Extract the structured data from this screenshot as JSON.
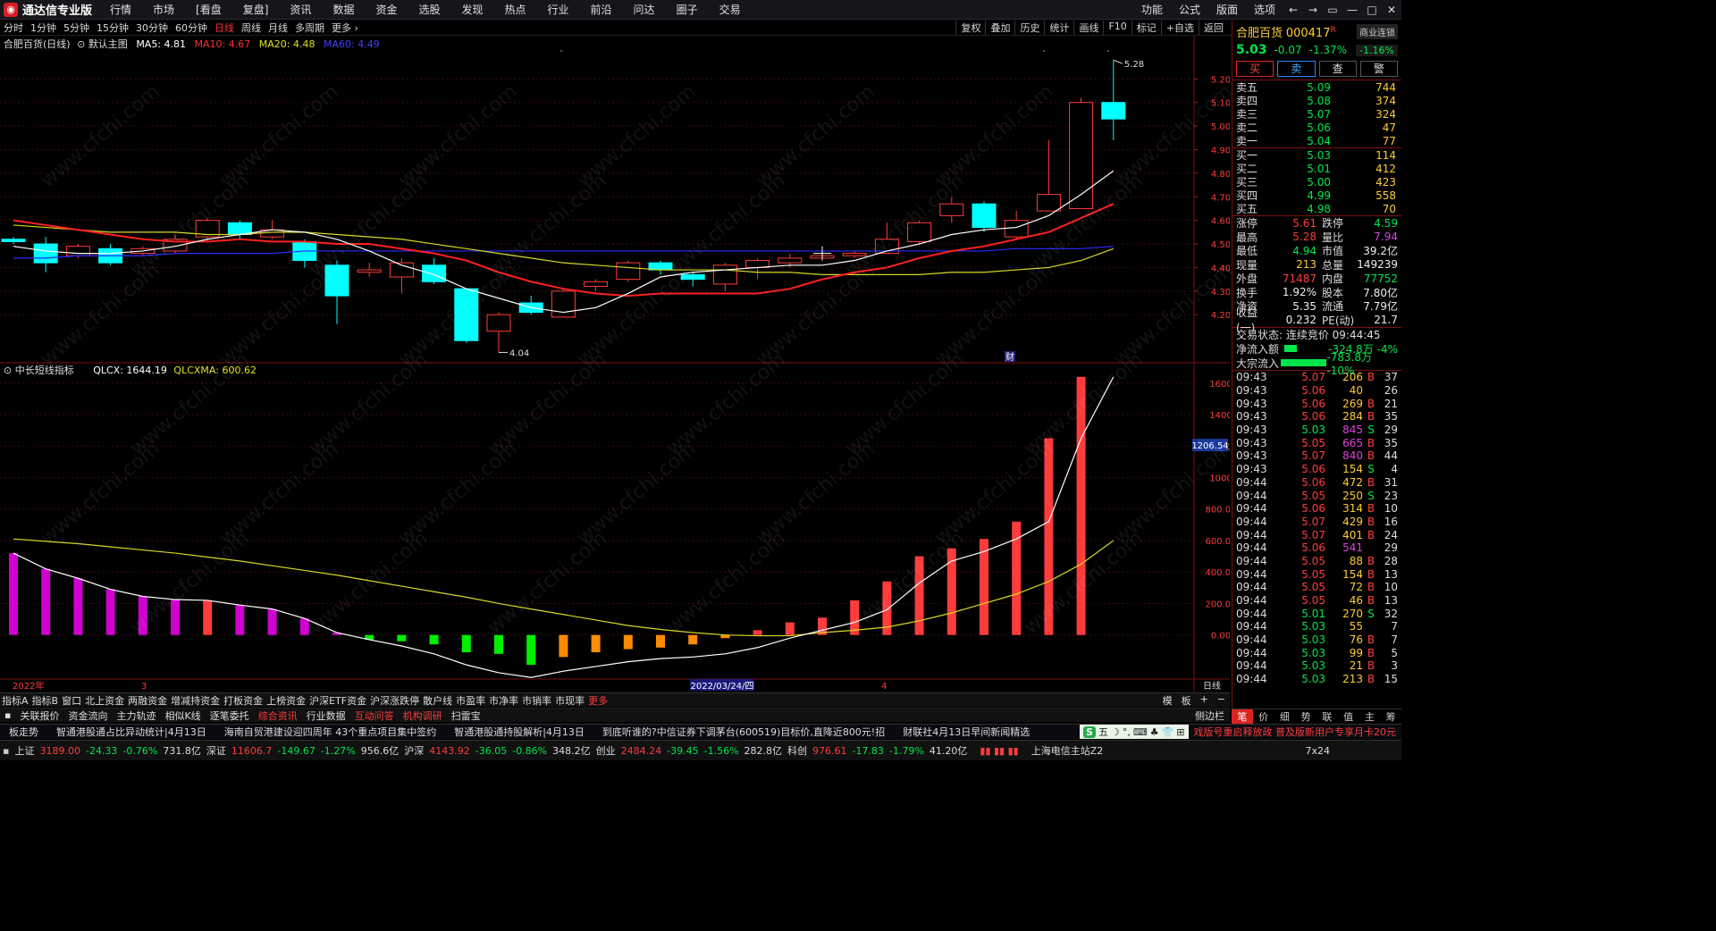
{
  "menubar": {
    "app_name": "通达信专业版",
    "items": [
      "行情",
      "市场",
      "[看盘",
      "复盘]",
      "资讯",
      "数据",
      "资金",
      "选股",
      "发现",
      "热点",
      "行业",
      "前沿",
      "问达",
      "圈子",
      "交易"
    ],
    "right_items": [
      "功能",
      "公式",
      "版面",
      "选项"
    ],
    "window_buttons": [
      "←",
      "→",
      "▭",
      "—",
      "□",
      "✕"
    ]
  },
  "periodbar": {
    "periods": [
      "分时",
      "1分钟",
      "5分钟",
      "15分钟",
      "30分钟",
      "60分钟",
      "日线",
      "周线",
      "月线",
      "多周期",
      "更多 ›"
    ],
    "active": "日线",
    "tools": [
      "复权",
      "叠加",
      "历史",
      "统计",
      "画线",
      "F10",
      "标记",
      "+自选",
      "返回"
    ]
  },
  "chart_header": {
    "stock_name": "合肥百货(日线)",
    "template": "默认主图",
    "ma5": "MA5: 4.81",
    "ma10": "MA10: 4.67",
    "ma20": "MA20: 4.48",
    "ma60": "MA60: 4.49"
  },
  "indicator_header": {
    "name": "中长短线指标",
    "qlcx": "QLCX: 1644.19",
    "qlcxma": "QLCXMA: 600.62"
  },
  "chart_labels": {
    "high_mark": "5.28",
    "low_mark": "4.04",
    "cai_mark": "财",
    "cursor_value": "1206.54",
    "date_label": "2022/03/24/四",
    "x_tick_left": "2022年",
    "x_tick_3": "3",
    "x_tick_4": "4",
    "period_label": "日线"
  },
  "chart_data": [
    {
      "type": "candlestick",
      "price_axis": [
        "5.20",
        "5.10",
        "5.00",
        "4.90",
        "4.80",
        "4.70",
        "4.60",
        "4.50",
        "4.40",
        "4.30",
        "4.20"
      ],
      "ylim": [
        4.0,
        5.33
      ],
      "candles": [
        {
          "o": 4.52,
          "c": 4.51,
          "h": 4.53,
          "l": 4.5
        },
        {
          "o": 4.5,
          "c": 4.42,
          "h": 4.53,
          "l": 4.38
        },
        {
          "o": 4.45,
          "c": 4.49,
          "h": 4.5,
          "l": 4.44
        },
        {
          "o": 4.48,
          "c": 4.42,
          "h": 4.5,
          "l": 4.41
        },
        {
          "o": 4.46,
          "c": 4.48,
          "h": 4.49,
          "l": 4.45
        },
        {
          "o": 4.47,
          "c": 4.52,
          "h": 4.54,
          "l": 4.46
        },
        {
          "o": 4.53,
          "c": 4.6,
          "h": 4.61,
          "l": 4.51
        },
        {
          "o": 4.59,
          "c": 4.54,
          "h": 4.6,
          "l": 4.52
        },
        {
          "o": 4.53,
          "c": 4.56,
          "h": 4.6,
          "l": 4.52
        },
        {
          "o": 4.51,
          "c": 4.43,
          "h": 4.52,
          "l": 4.4
        },
        {
          "o": 4.41,
          "c": 4.28,
          "h": 4.43,
          "l": 4.16
        },
        {
          "o": 4.38,
          "c": 4.39,
          "h": 4.42,
          "l": 4.36
        },
        {
          "o": 4.36,
          "c": 4.42,
          "h": 4.44,
          "l": 4.29
        },
        {
          "o": 4.41,
          "c": 4.34,
          "h": 4.44,
          "l": 4.33
        },
        {
          "o": 4.31,
          "c": 4.09,
          "h": 4.31,
          "l": 4.08
        },
        {
          "o": 4.13,
          "c": 4.2,
          "h": 4.21,
          "l": 4.04
        },
        {
          "o": 4.25,
          "c": 4.21,
          "h": 4.28,
          "l": 4.2
        },
        {
          "o": 4.19,
          "c": 4.3,
          "h": 4.31,
          "l": 4.19
        },
        {
          "o": 4.32,
          "c": 4.34,
          "h": 4.35,
          "l": 4.3
        },
        {
          "o": 4.35,
          "c": 4.42,
          "h": 4.43,
          "l": 4.34
        },
        {
          "o": 4.42,
          "c": 4.39,
          "h": 4.43,
          "l": 4.37
        },
        {
          "o": 4.37,
          "c": 4.35,
          "h": 4.38,
          "l": 4.32
        },
        {
          "o": 4.33,
          "c": 4.41,
          "h": 4.42,
          "l": 4.3
        },
        {
          "o": 4.4,
          "c": 4.43,
          "h": 4.44,
          "l": 4.35
        },
        {
          "o": 4.42,
          "c": 4.44,
          "h": 4.46,
          "l": 4.4
        },
        {
          "o": 4.44,
          "c": 4.45,
          "h": 4.46,
          "l": 4.43
        },
        {
          "o": 4.45,
          "c": 4.46,
          "h": 4.47,
          "l": 4.44
        },
        {
          "o": 4.46,
          "c": 4.52,
          "h": 4.59,
          "l": 4.46
        },
        {
          "o": 4.51,
          "c": 4.59,
          "h": 4.6,
          "l": 4.5
        },
        {
          "o": 4.62,
          "c": 4.67,
          "h": 4.7,
          "l": 4.59
        },
        {
          "o": 4.67,
          "c": 4.57,
          "h": 4.68,
          "l": 4.55
        },
        {
          "o": 4.53,
          "c": 4.6,
          "h": 4.64,
          "l": 4.52
        },
        {
          "o": 4.64,
          "c": 4.71,
          "h": 4.94,
          "l": 4.64
        },
        {
          "o": 4.65,
          "c": 5.1,
          "h": 5.12,
          "l": 4.65
        },
        {
          "o": 5.1,
          "c": 5.03,
          "h": 5.28,
          "l": 4.94
        }
      ],
      "ma5": [
        4.49,
        4.47,
        4.46,
        4.46,
        4.47,
        4.49,
        4.52,
        4.54,
        4.56,
        4.55,
        4.52,
        4.47,
        4.41,
        4.37,
        4.31,
        4.27,
        4.23,
        4.21,
        4.23,
        4.29,
        4.36,
        4.38,
        4.39,
        4.4,
        4.41,
        4.41,
        4.43,
        4.47,
        4.5,
        4.54,
        4.56,
        4.57,
        4.62,
        4.71,
        4.81
      ],
      "ma10": [
        4.6,
        4.58,
        4.56,
        4.54,
        4.52,
        4.51,
        4.51,
        4.52,
        4.51,
        4.51,
        4.5,
        4.5,
        4.48,
        4.46,
        4.43,
        4.38,
        4.34,
        4.31,
        4.29,
        4.28,
        4.29,
        4.29,
        4.29,
        4.29,
        4.31,
        4.35,
        4.38,
        4.4,
        4.44,
        4.47,
        4.49,
        4.52,
        4.55,
        4.61,
        4.67
      ],
      "ma20": [
        4.58,
        4.57,
        4.56,
        4.55,
        4.55,
        4.55,
        4.54,
        4.54,
        4.55,
        4.55,
        4.54,
        4.53,
        4.52,
        4.5,
        4.48,
        4.46,
        4.44,
        4.42,
        4.41,
        4.4,
        4.39,
        4.39,
        4.39,
        4.38,
        4.38,
        4.37,
        4.37,
        4.37,
        4.37,
        4.38,
        4.38,
        4.39,
        4.4,
        4.43,
        4.48
      ],
      "ma60": [
        4.44,
        4.44,
        4.45,
        4.45,
        4.45,
        4.46,
        4.46,
        4.46,
        4.46,
        4.47,
        4.47,
        4.47,
        4.47,
        4.47,
        4.47,
        4.47,
        4.47,
        4.47,
        4.47,
        4.47,
        4.47,
        4.47,
        4.47,
        4.47,
        4.47,
        4.47,
        4.47,
        4.47,
        4.47,
        4.47,
        4.47,
        4.48,
        4.48,
        4.48,
        4.49
      ]
    },
    {
      "type": "bar",
      "title": "中长短线指标",
      "value_axis": [
        "1600",
        "1400",
        "1200",
        "1000",
        "800.00",
        "600.00",
        "400.00",
        "200.00",
        "0.00"
      ],
      "ylim": [
        -280,
        1650
      ],
      "values": [
        520,
        420,
        360,
        290,
        245,
        225,
        220,
        190,
        165,
        105,
        15,
        -30,
        -40,
        -60,
        -110,
        -120,
        -190,
        -140,
        -110,
        -90,
        -80,
        -60,
        -20,
        30,
        80,
        110,
        220,
        340,
        500,
        550,
        610,
        720,
        1250,
        1640
      ],
      "colors": [
        "magenta",
        "magenta",
        "magenta",
        "magenta",
        "magenta",
        "magenta",
        "red",
        "magenta",
        "magenta",
        "magenta",
        "magenta",
        "green",
        "green",
        "green",
        "green",
        "green",
        "green",
        "orange",
        "orange",
        "orange",
        "orange",
        "orange",
        "orange",
        "red",
        "red",
        "red",
        "red",
        "red",
        "red",
        "red",
        "red",
        "red",
        "red",
        "red"
      ],
      "qlcx_line": [
        520,
        420,
        360,
        290,
        245,
        225,
        220,
        190,
        165,
        105,
        15,
        -30,
        -70,
        -120,
        -190,
        -240,
        -270,
        -230,
        -200,
        -170,
        -150,
        -140,
        -120,
        -80,
        -20,
        30,
        80,
        160,
        330,
        470,
        530,
        610,
        720,
        1250,
        1640
      ],
      "qlcxma_line": [
        610,
        595,
        580,
        560,
        540,
        520,
        495,
        470,
        440,
        410,
        380,
        345,
        310,
        275,
        240,
        200,
        165,
        130,
        95,
        60,
        35,
        15,
        0,
        -5,
        -5,
        15,
        30,
        50,
        90,
        140,
        200,
        260,
        340,
        450,
        600
      ]
    }
  ],
  "quote": {
    "name": "合肥百货",
    "code": "000417",
    "flag": "R",
    "tag": "商业连锁",
    "price": "5.03",
    "change": "-0.07",
    "pct": "-1.37%",
    "sector_pct": "-1.16%",
    "buttons": [
      "买",
      "卖",
      "查",
      "警"
    ],
    "asks": [
      {
        "label": "卖五",
        "price": "5.09",
        "vol": "744"
      },
      {
        "label": "卖四",
        "price": "5.08",
        "vol": "374"
      },
      {
        "label": "卖三",
        "price": "5.07",
        "vol": "324"
      },
      {
        "label": "卖二",
        "price": "5.06",
        "vol": "47"
      },
      {
        "label": "卖一",
        "price": "5.04",
        "vol": "77"
      }
    ],
    "bids": [
      {
        "label": "买一",
        "price": "5.03",
        "vol": "114"
      },
      {
        "label": "买二",
        "price": "5.01",
        "vol": "412"
      },
      {
        "label": "买三",
        "price": "5.00",
        "vol": "423"
      },
      {
        "label": "买四",
        "price": "4.99",
        "vol": "558"
      },
      {
        "label": "买五",
        "price": "4.98",
        "vol": "70"
      }
    ],
    "stats": [
      [
        "涨停",
        "5.61",
        "跌停",
        "4.59"
      ],
      [
        "最高",
        "5.28",
        "量比",
        "7.94"
      ],
      [
        "最低",
        "4.94",
        "市值",
        "39.2亿"
      ],
      [
        "现量",
        "213",
        "总量",
        "149239"
      ],
      [
        "外盘",
        "71487",
        "内盘",
        "77752"
      ],
      [
        "换手",
        "1.92%",
        "股本",
        "7.80亿"
      ],
      [
        "净资",
        "5.35",
        "流通",
        "7.79亿"
      ],
      [
        "收益(一)",
        "0.232",
        "PE(动)",
        "21.7"
      ]
    ],
    "trade_status": "交易状态: 连续竞价 09:44:45",
    "net_inflow_label": "净流入额",
    "net_inflow_value": "-324.8万 -4%",
    "bulk_inflow_label": "大宗流入",
    "bulk_inflow_value": "-783.8万 -10%",
    "net_inflow_bar": 0.14,
    "bulk_inflow_bar": 0.55,
    "ticks": [
      [
        "09:43",
        "5.07",
        "206",
        "B",
        "37"
      ],
      [
        "09:43",
        "5.06",
        "40",
        "",
        "26"
      ],
      [
        "09:43",
        "5.06",
        "269",
        "B",
        "21"
      ],
      [
        "09:43",
        "5.06",
        "284",
        "B",
        "35"
      ],
      [
        "09:43",
        "5.03",
        "845",
        "S",
        "29"
      ],
      [
        "09:43",
        "5.05",
        "665",
        "B",
        "35"
      ],
      [
        "09:43",
        "5.07",
        "840",
        "B",
        "44"
      ],
      [
        "09:43",
        "5.06",
        "154",
        "S",
        "4"
      ],
      [
        "09:44",
        "5.06",
        "472",
        "B",
        "31"
      ],
      [
        "09:44",
        "5.05",
        "250",
        "S",
        "23"
      ],
      [
        "09:44",
        "5.06",
        "314",
        "B",
        "10"
      ],
      [
        "09:44",
        "5.07",
        "429",
        "B",
        "16"
      ],
      [
        "09:44",
        "5.07",
        "401",
        "B",
        "24"
      ],
      [
        "09:44",
        "5.06",
        "541",
        "",
        "29"
      ],
      [
        "09:44",
        "5.05",
        "88",
        "B",
        "28"
      ],
      [
        "09:44",
        "5.05",
        "154",
        "B",
        "13"
      ],
      [
        "09:44",
        "5.05",
        "72",
        "B",
        "10"
      ],
      [
        "09:44",
        "5.05",
        "46",
        "B",
        "13"
      ],
      [
        "09:44",
        "5.01",
        "270",
        "S",
        "32"
      ],
      [
        "09:44",
        "5.03",
        "55",
        "",
        "7"
      ],
      [
        "09:44",
        "5.03",
        "76",
        "B",
        "7"
      ],
      [
        "09:44",
        "5.03",
        "99",
        "B",
        "5"
      ],
      [
        "09:44",
        "5.03",
        "21",
        "B",
        "3"
      ],
      [
        "09:44",
        "5.03",
        "213",
        "B",
        "15"
      ]
    ],
    "bottom_tabs": [
      "笔",
      "价",
      "细",
      "势",
      "联",
      "值",
      "主",
      "筹"
    ]
  },
  "tabbar1": {
    "items": [
      "指标A",
      "指标B",
      "窗口",
      "北上资金",
      "两融资金",
      "增减持资金",
      "打板资金",
      "上榜资金",
      "沪深ETF资金",
      "沪深涨跌停",
      "散户线",
      "市盈率",
      "市净率",
      "市销率",
      "市现率",
      "更多"
    ],
    "right": [
      "模",
      "板",
      "+",
      "−"
    ]
  },
  "tabbar2": {
    "items": [
      "关联报价",
      "资金流向",
      "主力轨迹",
      "相似K线",
      "逐笔委托",
      "综合资讯",
      "行业数据",
      "互动问答",
      "机构调研",
      "扫雷宝"
    ],
    "side": "侧边栏"
  },
  "news": {
    "items": [
      "板走势",
      "智通港股通占比异动统计|4月13日",
      "海南自贸港建设迎四周年 43个重点项目集中签约",
      "智通港股通持股解析|4月13日",
      "到底听谁的?中信证券下调茅台(600519)目标价,直降近800元!招",
      "财联社4月13日早间新闻精选"
    ],
    "ime": [
      "S",
      "五",
      "☽",
      "°,",
      "⌨",
      "♣",
      "👕",
      "⊞"
    ],
    "promo": "戏版号重启释放政 普及版新用户专享月卡20元"
  },
  "statusbar": {
    "items": [
      {
        "label": "上证",
        "value": "3189.00",
        "chg": "-24.33",
        "pct": "-0.76%",
        "amt": "731.8亿"
      },
      {
        "label": "深证",
        "value": "11606.7",
        "chg": "-149.67",
        "pct": "-1.27%",
        "amt": "956.6亿"
      },
      {
        "label": "沪深",
        "value": "4143.92",
        "chg": "-36.05",
        "pct": "-0.86%",
        "amt": "348.2亿"
      },
      {
        "label": "创业",
        "value": "2484.24",
        "chg": "-39.45",
        "pct": "-1.56%",
        "amt": "282.8亿"
      },
      {
        "label": "科创",
        "value": "976.61",
        "chg": "-17.83",
        "pct": "-1.79%",
        "amt": "41.20亿"
      }
    ],
    "server": "上海电信主站Z2",
    "clock": "7x24"
  },
  "colors": {
    "up": "#ff3c3c",
    "down": "#00e64a",
    "cyan": "#00ffff",
    "ma5": "#ffffff",
    "ma10": "#ff2020",
    "ma20": "#d8d820",
    "ma60": "#2b2bff",
    "magenta": "#d000d0",
    "orange": "#ff8c00",
    "green": "#00ee00"
  },
  "watermark": "www.cfchi.com"
}
